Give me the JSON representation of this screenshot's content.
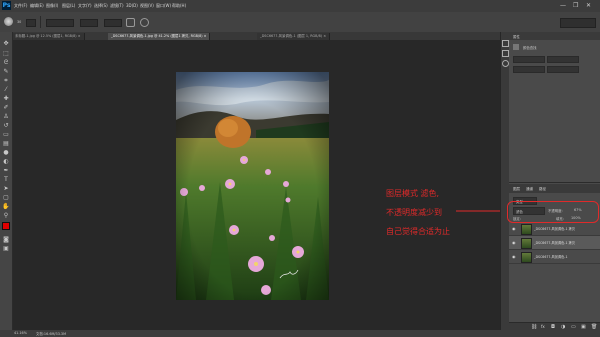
{
  "app": {
    "logo": "Ps"
  },
  "menu": [
    "文件(F)",
    "编辑(E)",
    "图像(I)",
    "图层(L)",
    "文字(Y)",
    "选择(S)",
    "滤镜(T)",
    "3D(D)",
    "视图(V)",
    "窗口(W)",
    "帮助(H)"
  ],
  "window_controls": {
    "minimize": "—",
    "restore": "❐",
    "close": "✕"
  },
  "options_bar": {
    "tool_icon": "brush-icon",
    "size": "30"
  },
  "tabs": [
    {
      "label": "未标题-1.jpg @ 12.5% (图层1, RGB/8) ×",
      "active": false
    },
    {
      "label": "_DSC6677-风景调色-1.jpg @ 41.2% (图层1 拷贝, RGB/8) ×",
      "active": true
    },
    {
      "label": "_DSC6677-风景调色-1 (图层 1, RGB/8) ×",
      "active": false
    }
  ],
  "annotation": {
    "line1": "图层模式 滤色,",
    "line2": "不透明度减少到",
    "line3": "自己觉得合适为止"
  },
  "right_panel": {
    "properties_title": "属性",
    "adjustments_label": "颜色查找",
    "layers_tabs": [
      "图层",
      "通道",
      "路径"
    ],
    "blend_mode": "滤色",
    "opacity_label": "不透明度:",
    "opacity_value": "67%",
    "lock_label": "锁定:",
    "fill_label": "填充:",
    "fill_value": "100%",
    "kind_label": "类型"
  },
  "layers": [
    {
      "name": "_DSC6677-风景调色-1 拷贝",
      "selected": false
    },
    {
      "name": "_DSC6677-风景调色-1 拷贝",
      "selected": true
    },
    {
      "name": "_DSC6677-风景调色-1",
      "selected": false
    }
  ],
  "status": {
    "zoom": "41.16%",
    "doc": "文档:16.6M/33.3M"
  },
  "colors": {
    "accent_red": "#e02a2a",
    "canvas_bg": "#282828",
    "ui_dark": "#3c3c3c"
  }
}
